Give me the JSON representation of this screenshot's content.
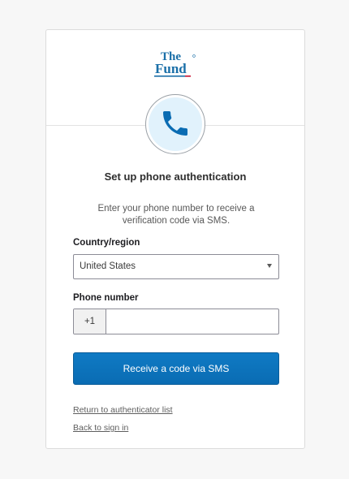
{
  "brand": {
    "logo_text_line1": "The",
    "logo_text_line2": "Fund",
    "logo_color": "#1a6fa8",
    "logo_accent": "#c8102e"
  },
  "factor": {
    "icon": "phone-icon",
    "icon_color": "#0a6cb3",
    "icon_bg": "#e1f2fc"
  },
  "page": {
    "title": "Set up phone authentication",
    "subtitle": "Enter your phone number to receive a verification code via SMS."
  },
  "form": {
    "country_label": "Country/region",
    "country_value": "United States",
    "phone_label": "Phone number",
    "phone_prefix": "+1",
    "phone_value": ""
  },
  "actions": {
    "primary_label": "Receive a code via SMS",
    "primary_color": "#0a6cb3",
    "return_link": "Return to authenticator list",
    "back_link": "Back to sign in"
  }
}
